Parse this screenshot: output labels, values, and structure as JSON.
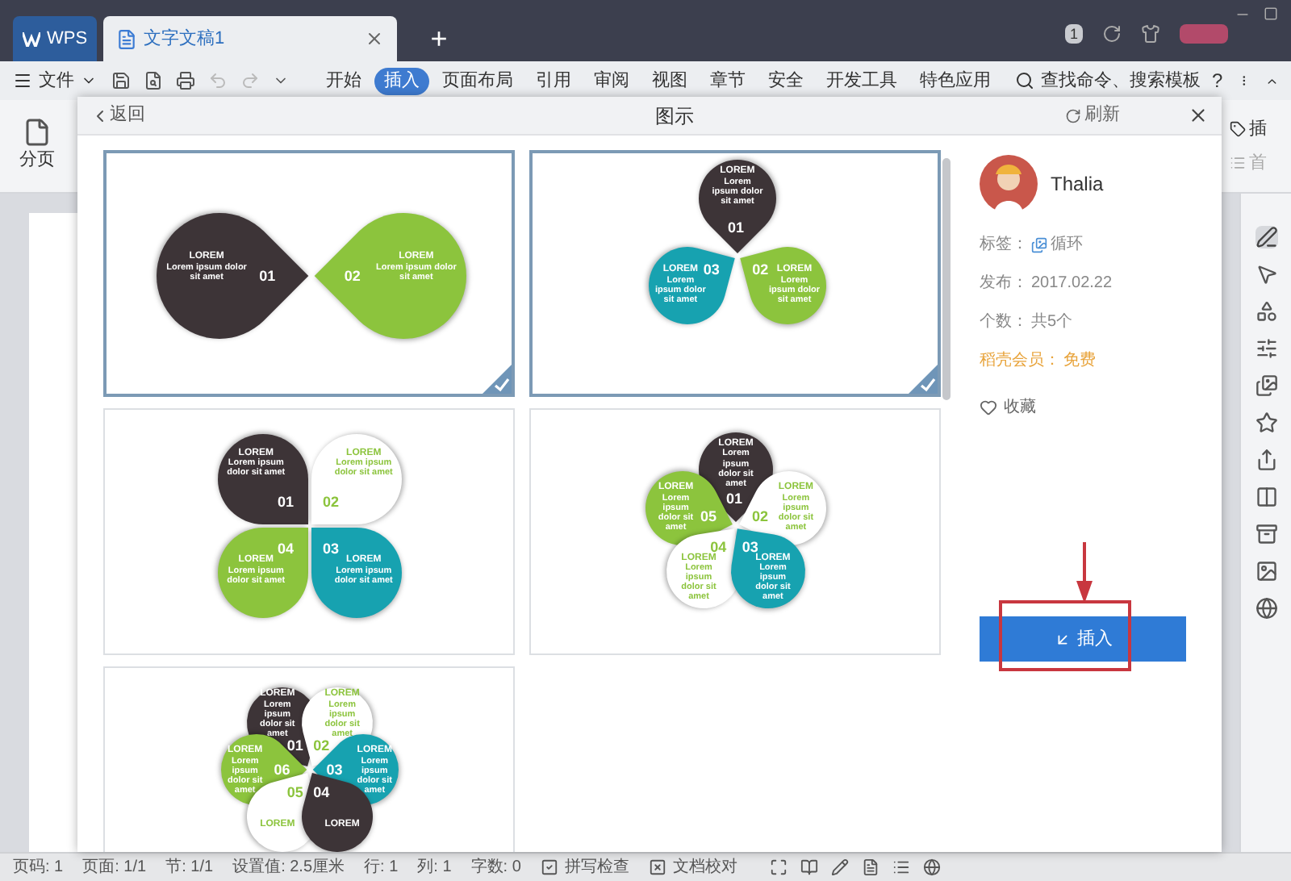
{
  "title_bar": {
    "app_tab": "WPS",
    "doc_tabs": [
      {
        "title": "文字文稿1",
        "selected": true
      }
    ],
    "new_tab": "+",
    "badge": "1"
  },
  "menu_bar": {
    "file_menu": "文件",
    "tabs": [
      {
        "label": "开始",
        "selected": false
      },
      {
        "label": "插入",
        "selected": true
      },
      {
        "label": "页面布局",
        "selected": false
      },
      {
        "label": "引用",
        "selected": false
      },
      {
        "label": "审阅",
        "selected": false
      },
      {
        "label": "视图",
        "selected": false
      },
      {
        "label": "章节",
        "selected": false
      },
      {
        "label": "安全",
        "selected": false
      },
      {
        "label": "开发工具",
        "selected": false
      },
      {
        "label": "特色应用",
        "selected": false
      }
    ],
    "search": "查找命令、搜索模板",
    "help": "?"
  },
  "ribbon": {
    "left_button": "分页",
    "right_items": [
      "插",
      "首"
    ]
  },
  "dialog": {
    "back": "返回",
    "title": "图示",
    "refresh": "刷新",
    "templates": [
      {
        "selected": true,
        "petals": [
          {
            "number": "01",
            "title": "LOREM",
            "body": "Lorem ipsum dolor sit amet",
            "color": "#3d3437"
          },
          {
            "number": "02",
            "title": "LOREM",
            "body": "Lorem ipsum dolor sit amet",
            "color": "#8cc43d"
          }
        ]
      },
      {
        "selected": true,
        "petals": [
          {
            "number": "01",
            "title": "LOREM",
            "body": "Lorem ipsum dolor sit amet",
            "color": "#3d3437"
          },
          {
            "number": "03",
            "title": "LOREM",
            "body": "Lorem ipsum dolor sit amet",
            "color": "#17a2b0"
          },
          {
            "number": "02",
            "title": "LOREM",
            "body": "Lorem ipsum dolor sit amet",
            "color": "#8cc43d"
          }
        ]
      },
      {
        "selected": false,
        "petals": [
          {
            "number": "01",
            "title": "LOREM",
            "body": "Lorem ipsum dolor sit amet",
            "color": "#3d3437"
          },
          {
            "number": "02",
            "title": "LOREM",
            "body": "Lorem ipsum dolor sit amet",
            "color": "#ffffff"
          },
          {
            "number": "04",
            "title": "LOREM",
            "body": "Lorem ipsum dolor sit amet",
            "color": "#8cc43d"
          },
          {
            "number": "03",
            "title": "LOREM",
            "body": "Lorem ipsum dolor sit amet",
            "color": "#17a2b0"
          }
        ]
      },
      {
        "selected": false,
        "petals": [
          {
            "number": "01",
            "title": "LOREM",
            "body": "Lorem ipsum dolor sit amet",
            "color": "#3d3437"
          },
          {
            "number": "05",
            "title": "LOREM",
            "body": "Lorem ipsum dolor sit amet",
            "color": "#8cc43d"
          },
          {
            "number": "02",
            "title": "LOREM",
            "body": "Lorem ipsum dolor sit amet",
            "color": "#ffffff"
          },
          {
            "number": "04",
            "title": "LOREM",
            "body": "Lorem ipsum dolor sit amet",
            "color": "#ffffff"
          },
          {
            "number": "03",
            "title": "LOREM",
            "body": "Lorem ipsum dolor sit amet",
            "color": "#17a2b0"
          }
        ]
      },
      {
        "selected": false,
        "petals": [
          {
            "number": "01",
            "title": "LOREM",
            "body": "Lorem ipsum dolor sit amet",
            "color": "#3d3437"
          },
          {
            "number": "02",
            "title": "LOREM",
            "body": "Lorem ipsum dolor sit amet",
            "color": "#ffffff"
          },
          {
            "number": "06",
            "title": "LOREM",
            "body": "Lorem ipsum dolor sit amet",
            "color": "#8cc43d"
          },
          {
            "number": "03",
            "title": "LOREM",
            "body": "Lorem ipsum dolor sit amet",
            "color": "#17a2b0"
          },
          {
            "number": "05",
            "title": "LOREM",
            "color": "#ffffff"
          },
          {
            "number": "04",
            "title": "LOREM",
            "color": "#3d3437"
          }
        ]
      }
    ],
    "detail": {
      "author": "Thalia",
      "fields": [
        {
          "label": "标签：",
          "value": "循环",
          "kind": "tag"
        },
        {
          "label": "发布：",
          "value": "2017.02.22",
          "kind": "plain"
        },
        {
          "label": "个数：",
          "value": "共5个",
          "kind": "plain"
        },
        {
          "label": "稻壳会员：",
          "value": "免费",
          "kind": "highlight"
        }
      ],
      "favorite": "收藏"
    },
    "insert_button": "插入"
  },
  "status_bar": {
    "items": [
      "页码: 1",
      "页面: 1/1",
      "节: 1/1",
      "设置值: 2.5厘米",
      "行: 1",
      "列: 1",
      "字数: 0"
    ],
    "spell_check": "拼写检查",
    "doc_check": "文档校对"
  }
}
